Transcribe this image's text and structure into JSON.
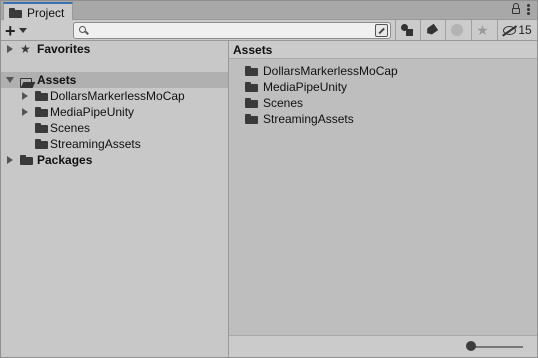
{
  "tab": {
    "title": "Project",
    "icon": "folder-icon"
  },
  "tab_actions": {
    "lock_icon": "lock-icon",
    "menu_icon": "kebab-menu-icon"
  },
  "toolbar": {
    "create_icon": "plus-icon",
    "search": {
      "value": "",
      "placeholder": ""
    },
    "hidden_packages_count": "15"
  },
  "tree": {
    "favorites": {
      "label": "Favorites",
      "icon": "star-icon"
    },
    "assets": {
      "label": "Assets",
      "icon": "folder-open-icon",
      "children": [
        {
          "label": "DollarsMarkerlessMoCap",
          "expandable": true
        },
        {
          "label": "MediaPipeUnity",
          "expandable": true
        },
        {
          "label": "Scenes",
          "expandable": false
        },
        {
          "label": "StreamingAssets",
          "expandable": false
        }
      ]
    },
    "packages": {
      "label": "Packages",
      "icon": "folder-icon"
    }
  },
  "right_pane": {
    "breadcrumb": "Assets",
    "items": [
      {
        "label": "DollarsMarkerlessMoCap"
      },
      {
        "label": "MediaPipeUnity"
      },
      {
        "label": "Scenes"
      },
      {
        "label": "StreamingAssets"
      }
    ]
  },
  "colors": {
    "accent": "#3a72b0",
    "selection": "#b0b0b0",
    "panel": "#c8c8c8"
  }
}
